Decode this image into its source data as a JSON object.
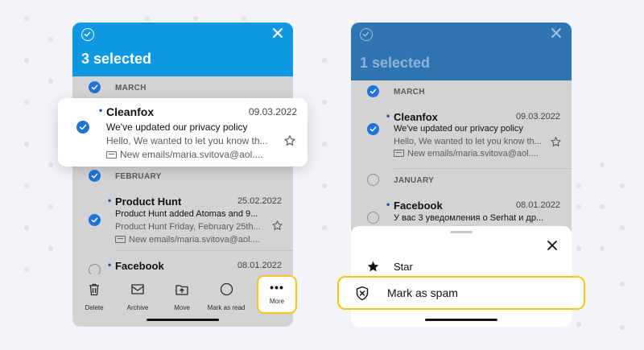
{
  "left_screen": {
    "title": "3 selected",
    "sections": {
      "march": "MARCH",
      "february": "FEBRUARY"
    },
    "emails": [
      {
        "sender": "Cleanfox",
        "date": "09.03.2022",
        "subject": "We've updated our privacy policy",
        "preview": "Hello, We wanted to let you know th...",
        "folder": "New emails/maria.svitova@aol....",
        "selected": true
      },
      {
        "sender": "Product Hunt",
        "date": "25.02.2022",
        "subject": "Product Hunt added Atomas and 9...",
        "preview": "Product Hunt Friday, February 25th...",
        "folder": "New emails/maria.svitova@aol....",
        "selected": true
      },
      {
        "sender": "Facebook",
        "date": "08.01.2022",
        "selected": false
      }
    ],
    "toolbar": {
      "delete": "Delete",
      "archive": "Archive",
      "move": "Move",
      "mark_as_read": "Mark as read",
      "more": "More"
    }
  },
  "right_screen": {
    "title": "1 selected",
    "sections": {
      "march": "MARCH",
      "january": "JANUARY"
    },
    "emails": [
      {
        "sender": "Cleanfox",
        "date": "09.03.2022",
        "subject": "We've updated our privacy policy",
        "preview": "Hello, We wanted to let you know th...",
        "folder": "New emails/maria.svitova@aol....",
        "selected": true
      },
      {
        "sender": "Facebook",
        "date": "08.01.2022",
        "subject": "У вас 3 уведомления о Serhat и др...",
        "selected": false
      }
    ],
    "sheet": {
      "star": "Star",
      "mark_as_spam": "Mark as spam"
    }
  },
  "colors": {
    "header_active": "#0e98e3",
    "header_dimmed": "#2f74b3",
    "check_blue": "#1f73d6",
    "highlight_yellow": "#f3c51e"
  }
}
